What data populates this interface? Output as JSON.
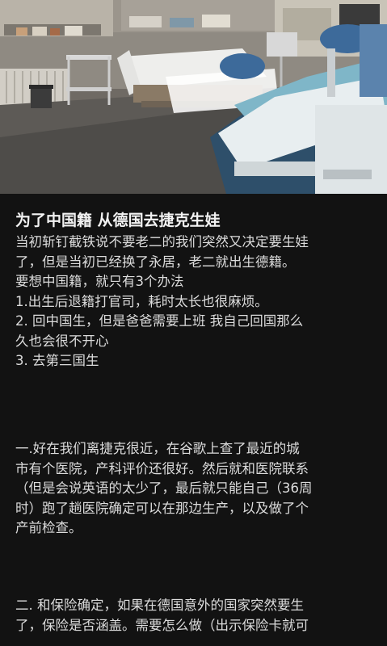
{
  "post": {
    "title": "为了中国籍 从德国去捷克生娃",
    "intro_lines": [
      "当初斩钉截铁说不要老二的我们突然又决定要生娃",
      "了，但是当初已经换了永居，老二就出生德籍。",
      "要想中国籍，就只有3个办法",
      "1.出生后退籍打官司，耗时太长也很麻烦。",
      "2. 回中国生，但是爸爸需要上班 我自己回国那么",
      "久也会很不开心",
      "3. 去第三国生"
    ],
    "section1_lines": [
      "一.好在我们离捷克很近，在谷歌上查了最近的城",
      "市有个医院，产科评价还很好。然后就和医院联系",
      "（但是会说英语的太少了，最后就只能自己（36周",
      "时）跑了趟医院确定可以在那边生产，以及做了个",
      "产前检查。"
    ],
    "section2_lines": [
      "二. 和保险确定，如果在德国意外的国家突然要生",
      "了，保险是否涵盖。需要怎么做（出示保险卡就可"
    ]
  }
}
